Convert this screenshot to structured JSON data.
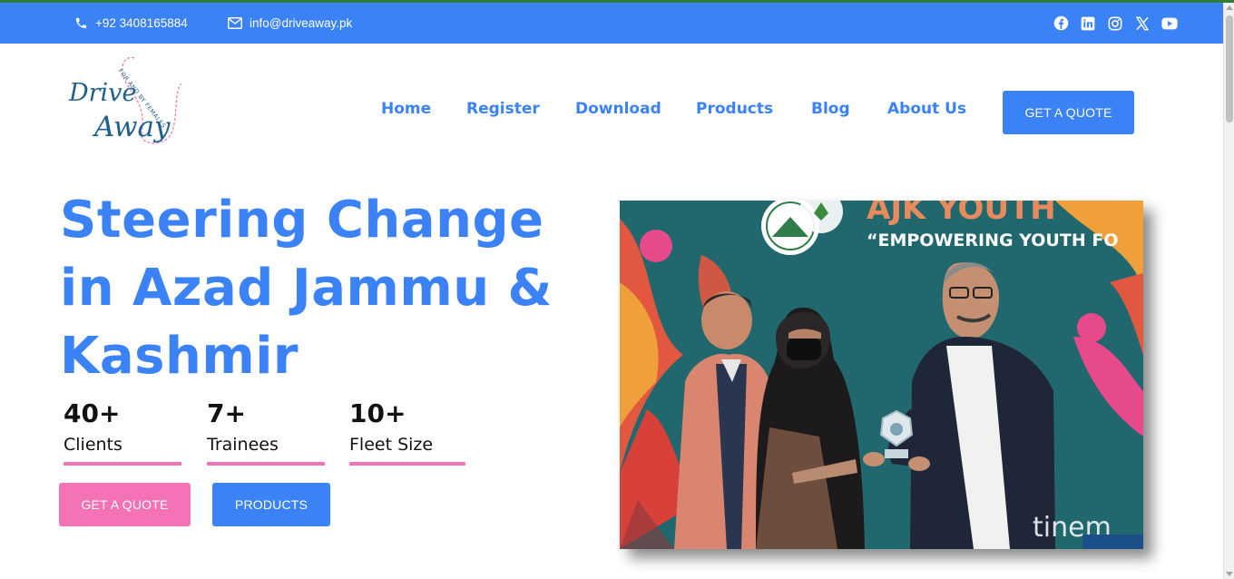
{
  "topbar": {
    "phone": "+92 3408165884",
    "email": "info@driveaway.pk",
    "socials": [
      "facebook-icon",
      "linkedin-icon",
      "instagram-icon",
      "x-icon",
      "youtube-icon"
    ]
  },
  "header": {
    "logo_text_top": "Drive",
    "logo_text_bottom": "Away",
    "logo_tagline": "FOR AND BY FEMALES",
    "nav": [
      "Home",
      "Register",
      "Download",
      "Products",
      "Blog",
      "About Us"
    ],
    "cta": "GET A QUOTE"
  },
  "hero": {
    "title": "Steering Change in Azad Jammu & Kashmir",
    "stats": [
      {
        "number": "40+",
        "label": "Clients"
      },
      {
        "number": "7+",
        "label": "Trainees"
      },
      {
        "number": "10+",
        "label": "Fleet Size"
      }
    ],
    "buttons": {
      "quote": "GET A QUOTE",
      "products": "PRODUCTS"
    },
    "photo": {
      "banner_title": "AJK YOUTH",
      "banner_subtitle": "“EMPOWERING YOUTH FO"
    }
  },
  "colors": {
    "primary": "#3b82f6",
    "accent_pink": "#f472b6",
    "top_strip": "#2e7d32"
  }
}
